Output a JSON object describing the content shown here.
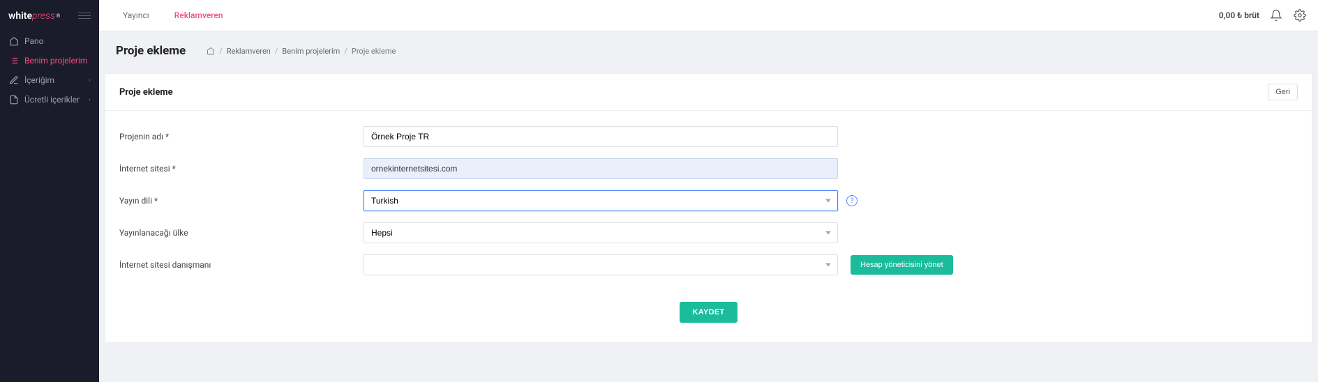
{
  "logo": {
    "part1": "white",
    "part2": "press"
  },
  "sidebar": {
    "items": [
      {
        "label": "Pano"
      },
      {
        "label": "Benim projelerim"
      },
      {
        "label": "İçeriğim"
      },
      {
        "label": "Ücretli içerikler"
      }
    ]
  },
  "topbar": {
    "tabs": [
      {
        "label": "Yayıncı"
      },
      {
        "label": "Reklamveren"
      }
    ],
    "balance": "0,00 ₺ brüt"
  },
  "page": {
    "title": "Proje ekleme",
    "breadcrumb": {
      "home": "⌂",
      "c1": "Reklamveren",
      "c2": "Benim projelerim",
      "c3": "Proje ekleme"
    }
  },
  "panel": {
    "title": "Proje ekleme",
    "back": "Geri"
  },
  "form": {
    "labels": {
      "name": "Projenin adı *",
      "website": "İnternet sitesi *",
      "lang": "Yayın dili *",
      "country": "Yayınlanacağı ülke",
      "advisor": "İnternet sitesi danışmanı"
    },
    "values": {
      "name": "Örnek Proje TR",
      "website": "ornekinternetsitesi.com",
      "lang": "Turkish",
      "country": "Hepsi",
      "advisor": ""
    },
    "manage_button": "Hesap yöneticisini yönet",
    "save_button": "KAYDET"
  }
}
